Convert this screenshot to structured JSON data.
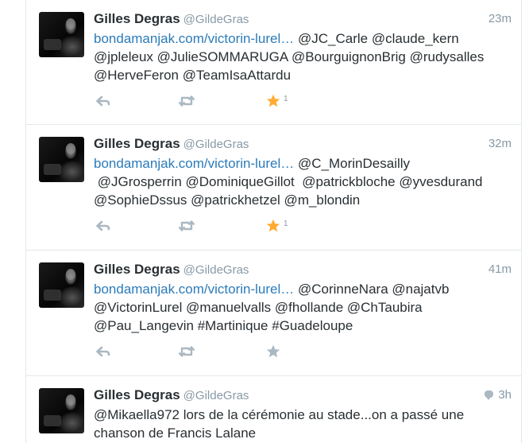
{
  "tweets": [
    {
      "name": "Gilles Degras",
      "handle": "@GildeGras",
      "time": "23m",
      "has_conversation": false,
      "lines": [
        {
          "link": "bondamanjak.com/victorin-lurel…",
          "text": " @JC_Carle @claude_kern"
        },
        {
          "link": "",
          "text": "@jpleleux @JulieSOMMARUGA @BourguignonBrig @rudysalles"
        },
        {
          "link": "",
          "text": "@HerveFeron @TeamIsaAttardu"
        }
      ],
      "favorited": true,
      "fav_count": "1"
    },
    {
      "name": "Gilles Degras",
      "handle": "@GildeGras",
      "time": "32m",
      "has_conversation": false,
      "lines": [
        {
          "link": "bondamanjak.com/victorin-lurel…",
          "text": " @C_MorinDesailly"
        },
        {
          "link": "",
          "text": " @JGrosperrin @DominiqueGillot  @patrickbloche @yvesdurand"
        },
        {
          "link": "",
          "text": "@SophieDssus @patrickhetzel @m_blondin"
        }
      ],
      "favorited": true,
      "fav_count": "1"
    },
    {
      "name": "Gilles Degras",
      "handle": "@GildeGras",
      "time": "41m",
      "has_conversation": false,
      "lines": [
        {
          "link": "bondamanjak.com/victorin-lurel…",
          "text": " @CorinneNara @najatvb"
        },
        {
          "link": "",
          "text": "@VictorinLurel @manuelvalls @fhollande @ChTaubira"
        },
        {
          "link": "",
          "text": "@Pau_Langevin #Martinique #Guadeloupe"
        }
      ],
      "favorited": false,
      "fav_count": ""
    },
    {
      "name": "Gilles Degras",
      "handle": "@GildeGras",
      "time": "3h",
      "has_conversation": true,
      "lines": [
        {
          "link": "",
          "text": "@Mikaella972 lors de la cérémonie au stade...on a passé une"
        },
        {
          "link": "",
          "text": "chanson de Francis Lalane"
        }
      ],
      "favorited": false,
      "fav_count": ""
    }
  ],
  "icons": {
    "reply": "reply-icon",
    "retweet": "retweet-icon",
    "favorite": "star-icon",
    "conversation": "conversation-icon"
  },
  "colors": {
    "link": "#2b7bb9",
    "text": "#292f33",
    "muted": "#8899a6",
    "icon": "#aab8c2",
    "favorite_active": "#ffac33",
    "divider": "#e1e8ed"
  }
}
